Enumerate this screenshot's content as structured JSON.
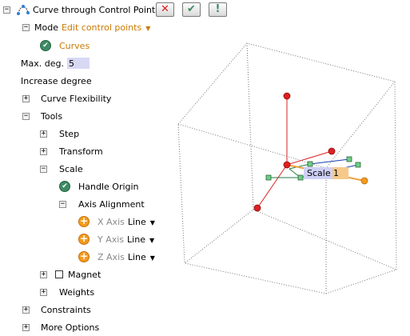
{
  "toolbar": {
    "title": "Curve through Control Points",
    "cancel": "✕",
    "ok": "✔",
    "apply": "!"
  },
  "tree": {
    "mode_label": "Mode",
    "mode_value": "Edit control points",
    "curves": "Curves",
    "max_deg_label": "Max. deg.",
    "max_deg_value": "5",
    "increase_degree": "Increase degree",
    "curve_flexibility": "Curve Flexibility",
    "tools": "Tools",
    "step": "Step",
    "transform": "Transform",
    "scale": "Scale",
    "handle_origin": "Handle Origin",
    "axis_alignment": "Axis Alignment",
    "x_axis": "X Axis",
    "x_value": "Line",
    "y_axis": "Y Axis",
    "y_value": "Line",
    "z_axis": "Z Axis",
    "z_value": "Line",
    "magnet": "Magnet",
    "weights": "Weights",
    "constraints": "Constraints",
    "more_options": "More Options"
  },
  "viewport": {
    "scale_label": "Scale",
    "scale_value": "1"
  },
  "colors": {
    "mode_orange": "#c97a00",
    "check_green": "#3d8a63",
    "axis_orange": "#f29b1d",
    "handle_red": "#e02020",
    "handle_green": "#4caf50",
    "scale_bg": "#cfd0f5"
  }
}
